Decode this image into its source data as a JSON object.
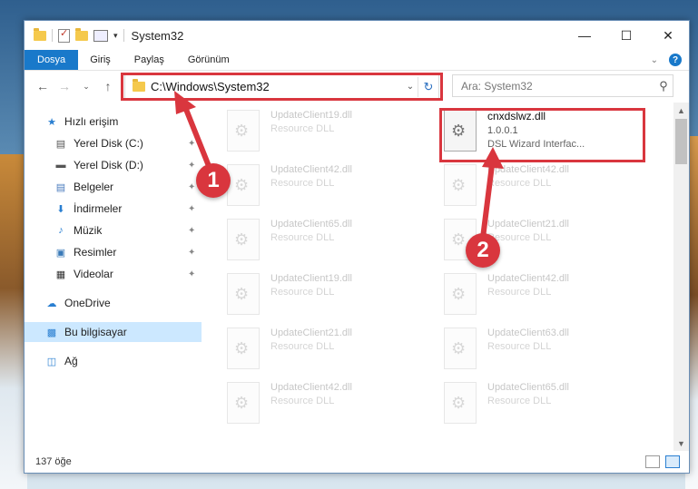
{
  "window": {
    "title": "System32"
  },
  "ribbon": {
    "tabs": [
      "Dosya",
      "Giriş",
      "Paylaş",
      "Görünüm"
    ]
  },
  "address": {
    "path": "C:\\Windows\\System32"
  },
  "search": {
    "placeholder": "Ara: System32"
  },
  "nav": {
    "items": [
      {
        "label": "Hızlı erişim",
        "icon": "star-icon"
      },
      {
        "label": "Yerel Disk (C:)",
        "icon": "drive-icon",
        "pinned": true
      },
      {
        "label": "Yerel Disk (D:)",
        "icon": "drive-icon",
        "pinned": true
      },
      {
        "label": "Belgeler",
        "icon": "documents-icon",
        "pinned": true
      },
      {
        "label": "İndirmeler",
        "icon": "download-icon",
        "pinned": true
      },
      {
        "label": "Müzik",
        "icon": "music-icon",
        "pinned": true
      },
      {
        "label": "Resimler",
        "icon": "pictures-icon",
        "pinned": true
      },
      {
        "label": "Videolar",
        "icon": "videos-icon",
        "pinned": true
      },
      {
        "label": "OneDrive",
        "icon": "cloud-icon"
      },
      {
        "label": "Bu bilgisayar",
        "icon": "computer-icon",
        "selected": true
      },
      {
        "label": "Ağ",
        "icon": "network-icon"
      }
    ]
  },
  "files": {
    "col1": [
      {
        "name": "UpdateClient19.dll",
        "desc": "Resource DLL"
      },
      {
        "name": "UpdateClient42.dll",
        "desc": "Resource DLL"
      },
      {
        "name": "UpdateClient65.dll",
        "desc": "Resource DLL"
      },
      {
        "name": "UpdateClient19.dll",
        "desc": "Resource DLL"
      },
      {
        "name": "UpdateClient21.dll",
        "desc": "Resource DLL"
      },
      {
        "name": "UpdateClient42.dll",
        "desc": "Resource DLL"
      }
    ],
    "col2": [
      {
        "name": "cnxdslwz.dll",
        "version": "1.0.0.1",
        "desc": "DSL Wizard Interfac..."
      },
      {
        "name": "UpdateClient42.dll",
        "desc": "Resource DLL"
      },
      {
        "name": "UpdateClient21.dll",
        "desc": "Resource DLL"
      },
      {
        "name": "UpdateClient42.dll",
        "desc": "Resource DLL"
      },
      {
        "name": "UpdateClient63.dll",
        "desc": "Resource DLL"
      },
      {
        "name": "UpdateClient65.dll",
        "desc": "Resource DLL"
      }
    ]
  },
  "status": {
    "count": "137 öğe"
  },
  "callouts": [
    "1",
    "2"
  ],
  "colors": {
    "accent": "#1979ca",
    "highlight": "#d9363e"
  }
}
